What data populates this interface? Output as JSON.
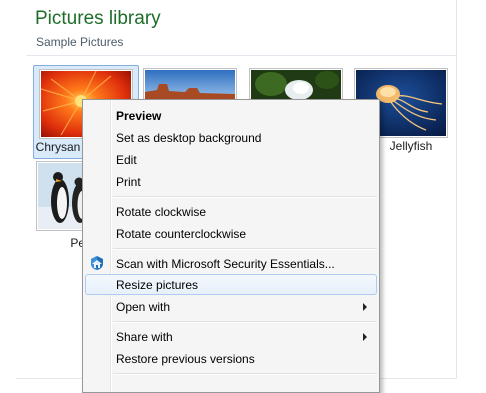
{
  "library": {
    "title": "Pictures library",
    "subtitle": "Sample Pictures"
  },
  "thumbnails": [
    {
      "name": "Chrysanthemum",
      "visible_label": "Chrysan",
      "selected": true
    },
    {
      "name": "Desert",
      "visible_label": "",
      "selected": false
    },
    {
      "name": "Hydrangeas",
      "visible_label": "",
      "selected": false
    },
    {
      "name": "Jellyfish",
      "visible_label": "Jellyfish",
      "selected": false
    },
    {
      "name": "Penguins",
      "visible_label": "Pen",
      "selected": false
    }
  ],
  "context_menu": {
    "items": [
      {
        "label": "Preview",
        "bold": true
      },
      {
        "label": "Set as desktop background"
      },
      {
        "label": "Edit"
      },
      {
        "label": "Print"
      },
      {
        "label": "Rotate clockwise"
      },
      {
        "label": "Rotate counterclockwise"
      },
      {
        "label": "Scan with Microsoft Security Essentials...",
        "icon": "shield-icon"
      },
      {
        "label": "Resize pictures",
        "highlighted": true
      },
      {
        "label": "Open with",
        "submenu": true
      },
      {
        "label": "Share with",
        "submenu": true
      },
      {
        "label": "Restore previous versions"
      }
    ]
  },
  "colors": {
    "title_green": "#1e6e2a",
    "selection_fill": "#d9ebfb",
    "selection_border": "#84acdd",
    "menu_bg": "#f5f5f5",
    "menu_highlight_border": "#aeccef"
  }
}
